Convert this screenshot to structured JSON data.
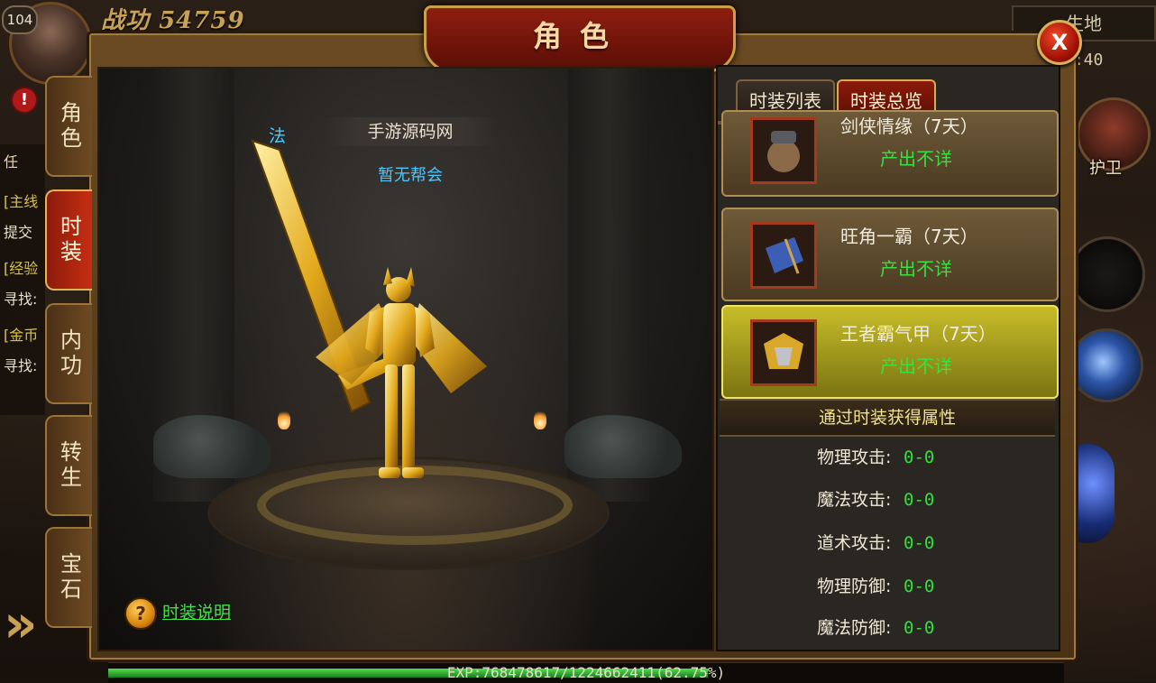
{
  "hud": {
    "level": "104",
    "power_label": "战功",
    "power_value": "54759",
    "quest_lines": [
      "任",
      "[主线",
      "提交",
      "[经验",
      "寻找:",
      "[金币",
      "寻找:"
    ],
    "map_name": "生地",
    "coord": "Y:40",
    "guard_label": "护卫",
    "exp_text": "EXP:768478617/1224662411(62.75%)",
    "exp_percent": 62.75
  },
  "panel": {
    "title": "角色",
    "close_label": "X"
  },
  "side_tabs": [
    {
      "label": "角色",
      "active": false
    },
    {
      "label": "时装",
      "active": true
    },
    {
      "label": "内功",
      "active": false
    },
    {
      "label": "转生",
      "active": false
    },
    {
      "label": "宝石",
      "active": false
    }
  ],
  "character": {
    "class_tag": "法",
    "name": "手游源码网",
    "guild": "暂无帮会"
  },
  "help": {
    "icon": "question-icon",
    "link_text": "时装说明"
  },
  "right": {
    "tabs": [
      {
        "label": "时装列表",
        "active": false
      },
      {
        "label": "时装总览",
        "active": true
      }
    ],
    "items": [
      {
        "name": "剑侠情缘（7天）",
        "source": "产出不详",
        "icon": "gourd-icon",
        "selected": false
      },
      {
        "name": "旺角一霸（7天）",
        "source": "产出不详",
        "icon": "blue-armor-icon",
        "selected": false
      },
      {
        "name": "王者霸气甲（7天）",
        "source": "产出不详",
        "icon": "gold-armor-icon",
        "selected": true
      }
    ],
    "attr_header": "通过时装获得属性",
    "attributes": [
      {
        "label": "物理攻击:",
        "value": "0-0"
      },
      {
        "label": "魔法攻击:",
        "value": "0-0"
      },
      {
        "label": "道术攻击:",
        "value": "0-0"
      },
      {
        "label": "物理防御:",
        "value": "0-0"
      },
      {
        "label": "魔法防御:",
        "value": "0-0"
      }
    ]
  },
  "colors": {
    "accent_green": "#31e03e",
    "accent_blue": "#49c8ff",
    "title_red": "#8e1e10",
    "gold": "#c9a045"
  }
}
